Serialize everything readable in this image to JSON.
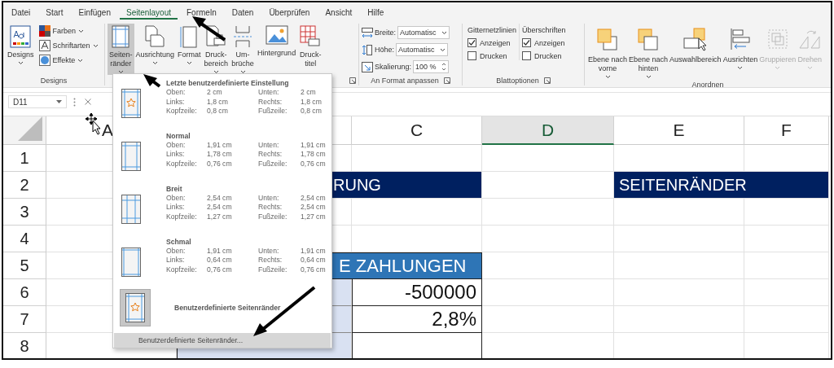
{
  "tabs": [
    {
      "label": "Datei",
      "selected": false
    },
    {
      "label": "Start",
      "selected": false
    },
    {
      "label": "Einfügen",
      "selected": false
    },
    {
      "label": "Seitenlayout",
      "selected": true
    },
    {
      "label": "Formeln",
      "selected": false
    },
    {
      "label": "Daten",
      "selected": false
    },
    {
      "label": "Überprüfen",
      "selected": false
    },
    {
      "label": "Ansicht",
      "selected": false
    },
    {
      "label": "Hilfe",
      "selected": false
    }
  ],
  "designs": {
    "label": "Designs",
    "main": {
      "label": "Designs",
      "dropdown": true
    },
    "items": [
      {
        "kind": "colors",
        "label": "Farben",
        "dropdown": true
      },
      {
        "kind": "fonts",
        "label": "Schriftarten",
        "dropdown": true
      },
      {
        "kind": "effects",
        "label": "Effekte",
        "dropdown": true
      }
    ]
  },
  "page_setup": {
    "launcher": true,
    "buttons": [
      {
        "kind": "margins",
        "lines": [
          "Seiten-",
          "ränder"
        ],
        "dropdown": true,
        "selected": true
      },
      {
        "kind": "orientation",
        "lines": [
          "Ausrichtung"
        ],
        "dropdown": true,
        "selected": false
      },
      {
        "kind": "size",
        "lines": [
          "Format"
        ],
        "dropdown": true,
        "selected": false
      },
      {
        "kind": "print-area",
        "lines": [
          "Druck-",
          "bereich"
        ],
        "dropdown": true,
        "selected": false
      },
      {
        "kind": "breaks",
        "lines": [
          "Um-",
          "brüche"
        ],
        "dropdown": true,
        "selected": false
      },
      {
        "kind": "background",
        "lines": [
          "Hintergrund"
        ],
        "dropdown": false,
        "selected": false
      },
      {
        "kind": "print-titles",
        "lines": [
          "Druck-",
          "titel"
        ],
        "dropdown": false,
        "selected": false
      }
    ]
  },
  "scale_to_fit": {
    "label": "An Format anpassen",
    "launcher": true,
    "fields": [
      {
        "kind": "width",
        "label": "Breite:",
        "value": "Automatisc"
      },
      {
        "kind": "height",
        "label": "Höhe:",
        "value": "Automatisc"
      },
      {
        "kind": "scale",
        "label": "Skalierung:",
        "value": "100 %"
      }
    ]
  },
  "sheet_options": {
    "label": "Blattoptionen",
    "launcher": true,
    "columns": [
      {
        "title": "Gitternetzlinien",
        "options": [
          {
            "label": "Anzeigen",
            "checked": true
          },
          {
            "label": "Drucken",
            "checked": false
          }
        ]
      },
      {
        "title": "Überschriften",
        "options": [
          {
            "label": "Anzeigen",
            "checked": true
          },
          {
            "label": "Drucken",
            "checked": false
          }
        ]
      }
    ]
  },
  "arrange": {
    "label": "Anordnen",
    "buttons": [
      {
        "kind": "forward",
        "lines": [
          "Ebene nach",
          "vorne"
        ],
        "dropdown": true,
        "disabled": false
      },
      {
        "kind": "backward",
        "lines": [
          "Ebene nach",
          "hinten"
        ],
        "dropdown": true,
        "disabled": false
      },
      {
        "kind": "selection",
        "lines": [
          "Auswahlbereich"
        ],
        "dropdown": false,
        "disabled": false
      },
      {
        "kind": "align",
        "lines": [
          "Ausrichten"
        ],
        "dropdown": true,
        "disabled": false
      },
      {
        "kind": "group",
        "lines": [
          "Gruppieren"
        ],
        "dropdown": true,
        "disabled": true
      },
      {
        "kind": "rotate",
        "lines": [
          "Drehen"
        ],
        "dropdown": true,
        "disabled": true
      }
    ]
  },
  "formula_bar": {
    "name_box": "D11"
  },
  "columns": [
    {
      "label": "A",
      "selected": false
    },
    {
      "selected": false
    },
    {
      "label": "C",
      "selected": false
    },
    {
      "label": "D",
      "selected": true
    },
    {
      "label": "E",
      "selected": false
    },
    {
      "label": "F",
      "selected": false
    }
  ],
  "rows": [
    {
      "header": "1",
      "cells": [
        {
          "kind": "empty"
        },
        {
          "kind": "empty"
        },
        {
          "kind": "empty"
        },
        {
          "kind": "empty"
        },
        {
          "kind": "empty"
        },
        {
          "kind": "empty"
        }
      ]
    },
    {
      "header": "2",
      "cells": [
        {
          "kind": "empty"
        },
        {
          "kind": "title",
          "merged": true,
          "text": "RUNG"
        },
        {
          "kind": "empty"
        },
        {
          "kind": "title",
          "merged": true,
          "text": "SEITENRÄNDER"
        }
      ]
    },
    {
      "header": "3",
      "cells": [
        {
          "kind": "empty"
        },
        {
          "kind": "empty"
        },
        {
          "kind": "empty"
        },
        {
          "kind": "empty"
        },
        {
          "kind": "empty"
        },
        {
          "kind": "empty"
        }
      ]
    },
    {
      "header": "4",
      "cells": [
        {
          "kind": "empty"
        },
        {
          "kind": "empty"
        },
        {
          "kind": "empty"
        },
        {
          "kind": "empty"
        },
        {
          "kind": "empty"
        },
        {
          "kind": "empty"
        }
      ]
    },
    {
      "header": "5",
      "cells": [
        {
          "kind": "empty"
        },
        {
          "kind": "header",
          "merged": true,
          "text": "E ZAHLUNGEN"
        },
        {
          "kind": "empty"
        },
        {
          "kind": "empty"
        },
        {
          "kind": "empty"
        }
      ]
    },
    {
      "header": "6",
      "cells": [
        {
          "kind": "empty"
        },
        {
          "kind": "label"
        },
        {
          "kind": "value",
          "text": "-500000"
        },
        {
          "kind": "empty"
        },
        {
          "kind": "empty"
        },
        {
          "kind": "empty"
        }
      ]
    },
    {
      "header": "7",
      "cells": [
        {
          "kind": "empty"
        },
        {
          "kind": "label"
        },
        {
          "kind": "value",
          "text": "2,8%"
        },
        {
          "kind": "empty"
        },
        {
          "kind": "empty"
        },
        {
          "kind": "empty"
        }
      ]
    },
    {
      "header": "8",
      "cells": [
        {
          "kind": "empty"
        },
        {
          "kind": "label"
        },
        {
          "kind": "value"
        },
        {
          "kind": "empty"
        },
        {
          "kind": "empty"
        },
        {
          "kind": "empty"
        }
      ]
    }
  ],
  "margins_menu": {
    "presets": [
      {
        "kind": "last",
        "title": "Letzte benutzerdefinierte Einstellung",
        "lines": [
          [
            "Oben:",
            "2 cm",
            "Unten:",
            "2 cm"
          ],
          [
            "Links:",
            "1,8 cm",
            "Rechts:",
            "1,8 cm"
          ],
          [
            "Kopfzeile:",
            "0,8 cm",
            "Fußzeile:",
            "0,8 cm"
          ]
        ]
      },
      {
        "kind": "normal",
        "title": "Normal",
        "lines": [
          [
            "Oben:",
            "1,91 cm",
            "Unten:",
            "1,91 cm"
          ],
          [
            "Links:",
            "1,78 cm",
            "Rechts:",
            "1,78 cm"
          ],
          [
            "Kopfzeile:",
            "0,76 cm",
            "Fußzeile:",
            "0,76 cm"
          ]
        ]
      },
      {
        "kind": "wide",
        "title": "Breit",
        "lines": [
          [
            "Oben:",
            "2,54 cm",
            "Unten:",
            "2,54 cm"
          ],
          [
            "Links:",
            "2,54 cm",
            "Rechts:",
            "2,54 cm"
          ],
          [
            "Kopfzeile:",
            "1,27 cm",
            "Fußzeile:",
            "1,27 cm"
          ]
        ]
      },
      {
        "kind": "narrow",
        "title": "Schmal",
        "lines": [
          [
            "Oben:",
            "1,91 cm",
            "Unten:",
            "1,91 cm"
          ],
          [
            "Links:",
            "0,64 cm",
            "Rechts:",
            "0,64 cm"
          ],
          [
            "Kopfzeile:",
            "0,76 cm",
            "Fußzeile:",
            "0,76 cm"
          ]
        ]
      }
    ],
    "custom": {
      "title": "Benutzerdefinierte Seitenränder",
      "selected": true
    },
    "footer": {
      "label": "Benutzerdefinierte Seitenränder...",
      "selected": true
    }
  }
}
